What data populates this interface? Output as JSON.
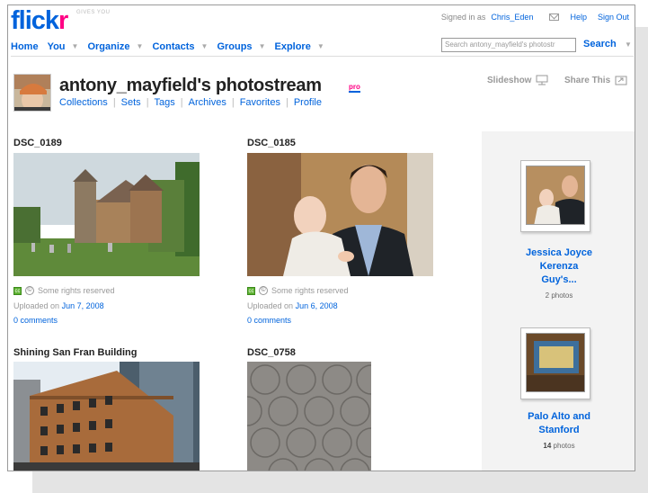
{
  "header": {
    "logo_main": "flick",
    "logo_accent": "r",
    "logo_tagline": "GIVES YOU",
    "signed_in_prefix": "Signed in as",
    "username": "Chris_Eden",
    "help": "Help",
    "sign_out": "Sign Out"
  },
  "nav": {
    "items": [
      "Home",
      "You",
      "Organize",
      "Contacts",
      "Groups",
      "Explore"
    ],
    "search_placeholder": "Search antony_mayfield's photostr",
    "search_button": "Search"
  },
  "profile": {
    "title": "antony_mayfield's photostream",
    "pro_badge": "pro",
    "subnav": [
      "Collections",
      "Sets",
      "Tags",
      "Archives",
      "Favorites",
      "Profile"
    ],
    "slideshow": "Slideshow",
    "share": "Share This"
  },
  "photos": [
    {
      "title": "DSC_0189",
      "license": "Some rights reserved",
      "uploaded_prefix": "Uploaded on",
      "date": "Jun 7, 2008",
      "comments": "0 comments"
    },
    {
      "title": "DSC_0185",
      "license": "Some rights reserved",
      "uploaded_prefix": "Uploaded on",
      "date": "Jun 6, 2008",
      "comments": "0 comments"
    },
    {
      "title": "Shining San Fran Building"
    },
    {
      "title": "DSC_0758"
    }
  ],
  "sets": [
    {
      "title_line1": "Jessica Joyce",
      "title_line2": "Kerenza",
      "title_line3": "Guy's...",
      "count": "2 photos"
    },
    {
      "title_line1": "Palo Alto and",
      "title_line2": "Stanford",
      "count_num": "14",
      "count_label": "photos"
    }
  ],
  "colors": {
    "brand_blue": "#0063dc",
    "brand_pink": "#ff0084",
    "license_green": "#5fb233"
  }
}
